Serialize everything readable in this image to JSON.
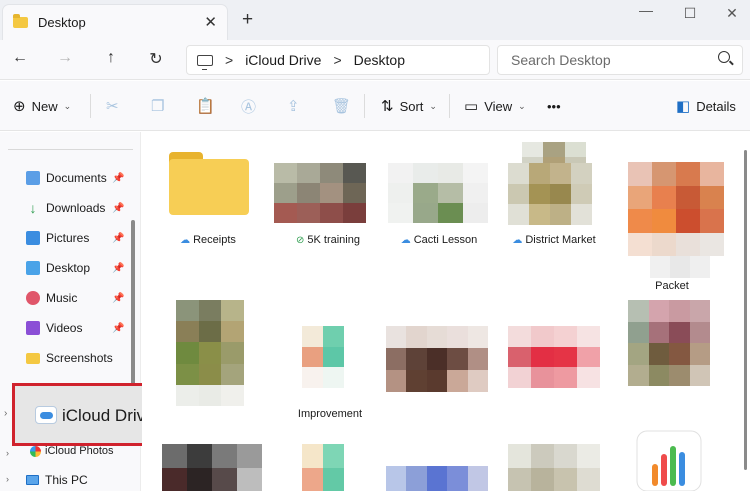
{
  "tab": {
    "title": "Desktop",
    "close": "✕",
    "new_tab": "+"
  },
  "window_controls": {
    "minimize": "—",
    "maximize": "☐",
    "close": "✕"
  },
  "nav": {
    "back": "←",
    "forward": "→",
    "up": "↑",
    "refresh": "↻"
  },
  "breadcrumb": {
    "sep": ">",
    "items": [
      "iCloud Drive",
      "Desktop"
    ]
  },
  "search": {
    "placeholder": "Search Desktop"
  },
  "commands": {
    "new_label": "New",
    "sort_label": "Sort",
    "view_label": "View",
    "more": "•••",
    "details_label": "Details",
    "icons": {
      "new": "plus-icon",
      "cut": "scissors-icon",
      "copy": "copy-icon",
      "paste": "paste-icon",
      "rename": "rename-icon",
      "share": "share-icon",
      "delete": "trash-icon",
      "sort": "sort-arrows-icon",
      "view": "view-icon",
      "details": "details-pane-icon"
    }
  },
  "sidebar": {
    "items": [
      {
        "label": "Documents",
        "icon": "documents-icon",
        "pinned": true
      },
      {
        "label": "Downloads",
        "icon": "downloads-icon",
        "pinned": true
      },
      {
        "label": "Pictures",
        "icon": "pictures-icon",
        "pinned": true
      },
      {
        "label": "Desktop",
        "icon": "desktop-icon",
        "pinned": true
      },
      {
        "label": "Music",
        "icon": "music-icon",
        "pinned": true
      },
      {
        "label": "Videos",
        "icon": "videos-icon",
        "pinned": true
      },
      {
        "label": "Screenshots",
        "icon": "folder-icon",
        "pinned": false
      }
    ],
    "pin_glyph": "📌",
    "icloud_drive": "iCloud Drive",
    "icloud_photos": "iCloud Photos",
    "this_pc": "This PC",
    "highlight_color": "#d0222d"
  },
  "files": [
    {
      "name": "Receipts",
      "status": "cloud"
    },
    {
      "name": "5K training",
      "status": "synced"
    },
    {
      "name": "Cacti Lesson",
      "status": "cloud"
    },
    {
      "name": "District Market",
      "status": "cloud"
    },
    {
      "name": "Packet",
      "status": ""
    },
    {
      "name": "Improvement",
      "status": ""
    }
  ],
  "colors": {
    "accent": "#3b8de0",
    "folder": "#f7ce55"
  }
}
